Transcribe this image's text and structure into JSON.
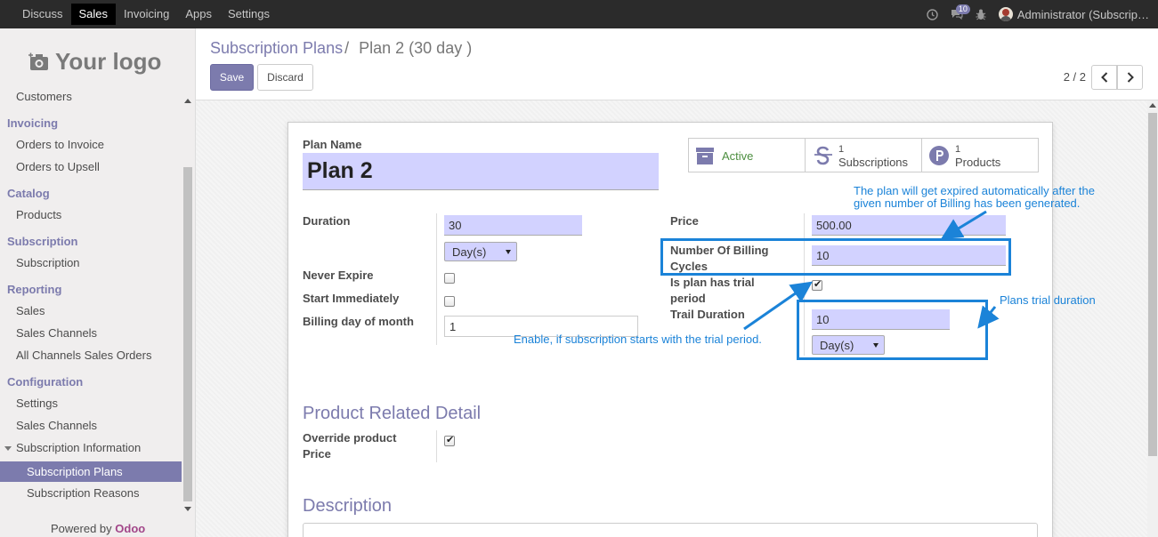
{
  "topbar": {
    "menu": [
      "Discuss",
      "Sales",
      "Invoicing",
      "Apps",
      "Settings"
    ],
    "active": "Sales",
    "message_count": "10",
    "user": "Administrator (Subscrip…"
  },
  "sidebar": {
    "logo_text": "Your logo",
    "cut_item": "Customers",
    "sections": [
      {
        "title": "Invoicing",
        "items": [
          "Orders to Invoice",
          "Orders to Upsell"
        ]
      },
      {
        "title": "Catalog",
        "items": [
          "Products"
        ]
      },
      {
        "title": "Subscription",
        "items": [
          "Subscription"
        ]
      },
      {
        "title": "Reporting",
        "items": [
          "Sales",
          "Sales Channels",
          "All Channels Sales Orders"
        ]
      },
      {
        "title": "Configuration",
        "items": [
          "Settings",
          "Sales Channels"
        ]
      }
    ],
    "group": "Subscription Information",
    "group_items": [
      "Subscription Plans",
      "Subscription Reasons"
    ],
    "powered_prefix": "Powered by",
    "powered_brand": "Odoo"
  },
  "control": {
    "breadcrumb_parent": "Subscription Plans",
    "breadcrumb_sep": "/",
    "breadcrumb_current": "Plan 2 (30 day )",
    "save_label": "Save",
    "discard_label": "Discard",
    "pager": "2 / 2"
  },
  "form": {
    "plan_name_label": "Plan Name",
    "plan_name": "Plan 2",
    "stats": {
      "active_label": "Active",
      "subscriptions_count": "1",
      "subscriptions_label": "Subscriptions",
      "products_count": "1",
      "products_label": "Products"
    },
    "duration_label": "Duration",
    "duration_value": "30",
    "duration_unit": "Day(s)",
    "never_expire_label": "Never Expire",
    "never_expire": false,
    "start_immediately_label": "Start Immediately",
    "start_immediately": false,
    "billing_day_label": "Billing day of month",
    "billing_day_value": "1",
    "price_label": "Price",
    "price_value": "500.00",
    "billing_cycles_label_1": "Number Of Billing",
    "billing_cycles_label_2": "Cycles",
    "billing_cycles_value": "10",
    "trial_label_1": "Is plan has trial",
    "trial_label_2": "period",
    "trial_checked": true,
    "trail_duration_label": "Trail Duration",
    "trail_duration_value": "10",
    "trail_duration_unit": "Day(s)",
    "product_section_title": "Product Related Detail",
    "override_label_1": "Override product",
    "override_label_2": "Price",
    "override_checked": true,
    "description_title": "Description"
  },
  "annotations": {
    "billing_note_1": "The plan will get expired automatically after the",
    "billing_note_2": "given number of Billing has been generated.",
    "trial_duration_note": "Plans trial duration",
    "trial_enable_note": "Enable, if subscription starts with the trial period.",
    "color": "#1b83d8"
  },
  "colors": {
    "accent": "#7c7bad",
    "topbar": "#2b2b2b",
    "required_field": "#d2d2ff",
    "odoo_brand": "#a24689"
  }
}
